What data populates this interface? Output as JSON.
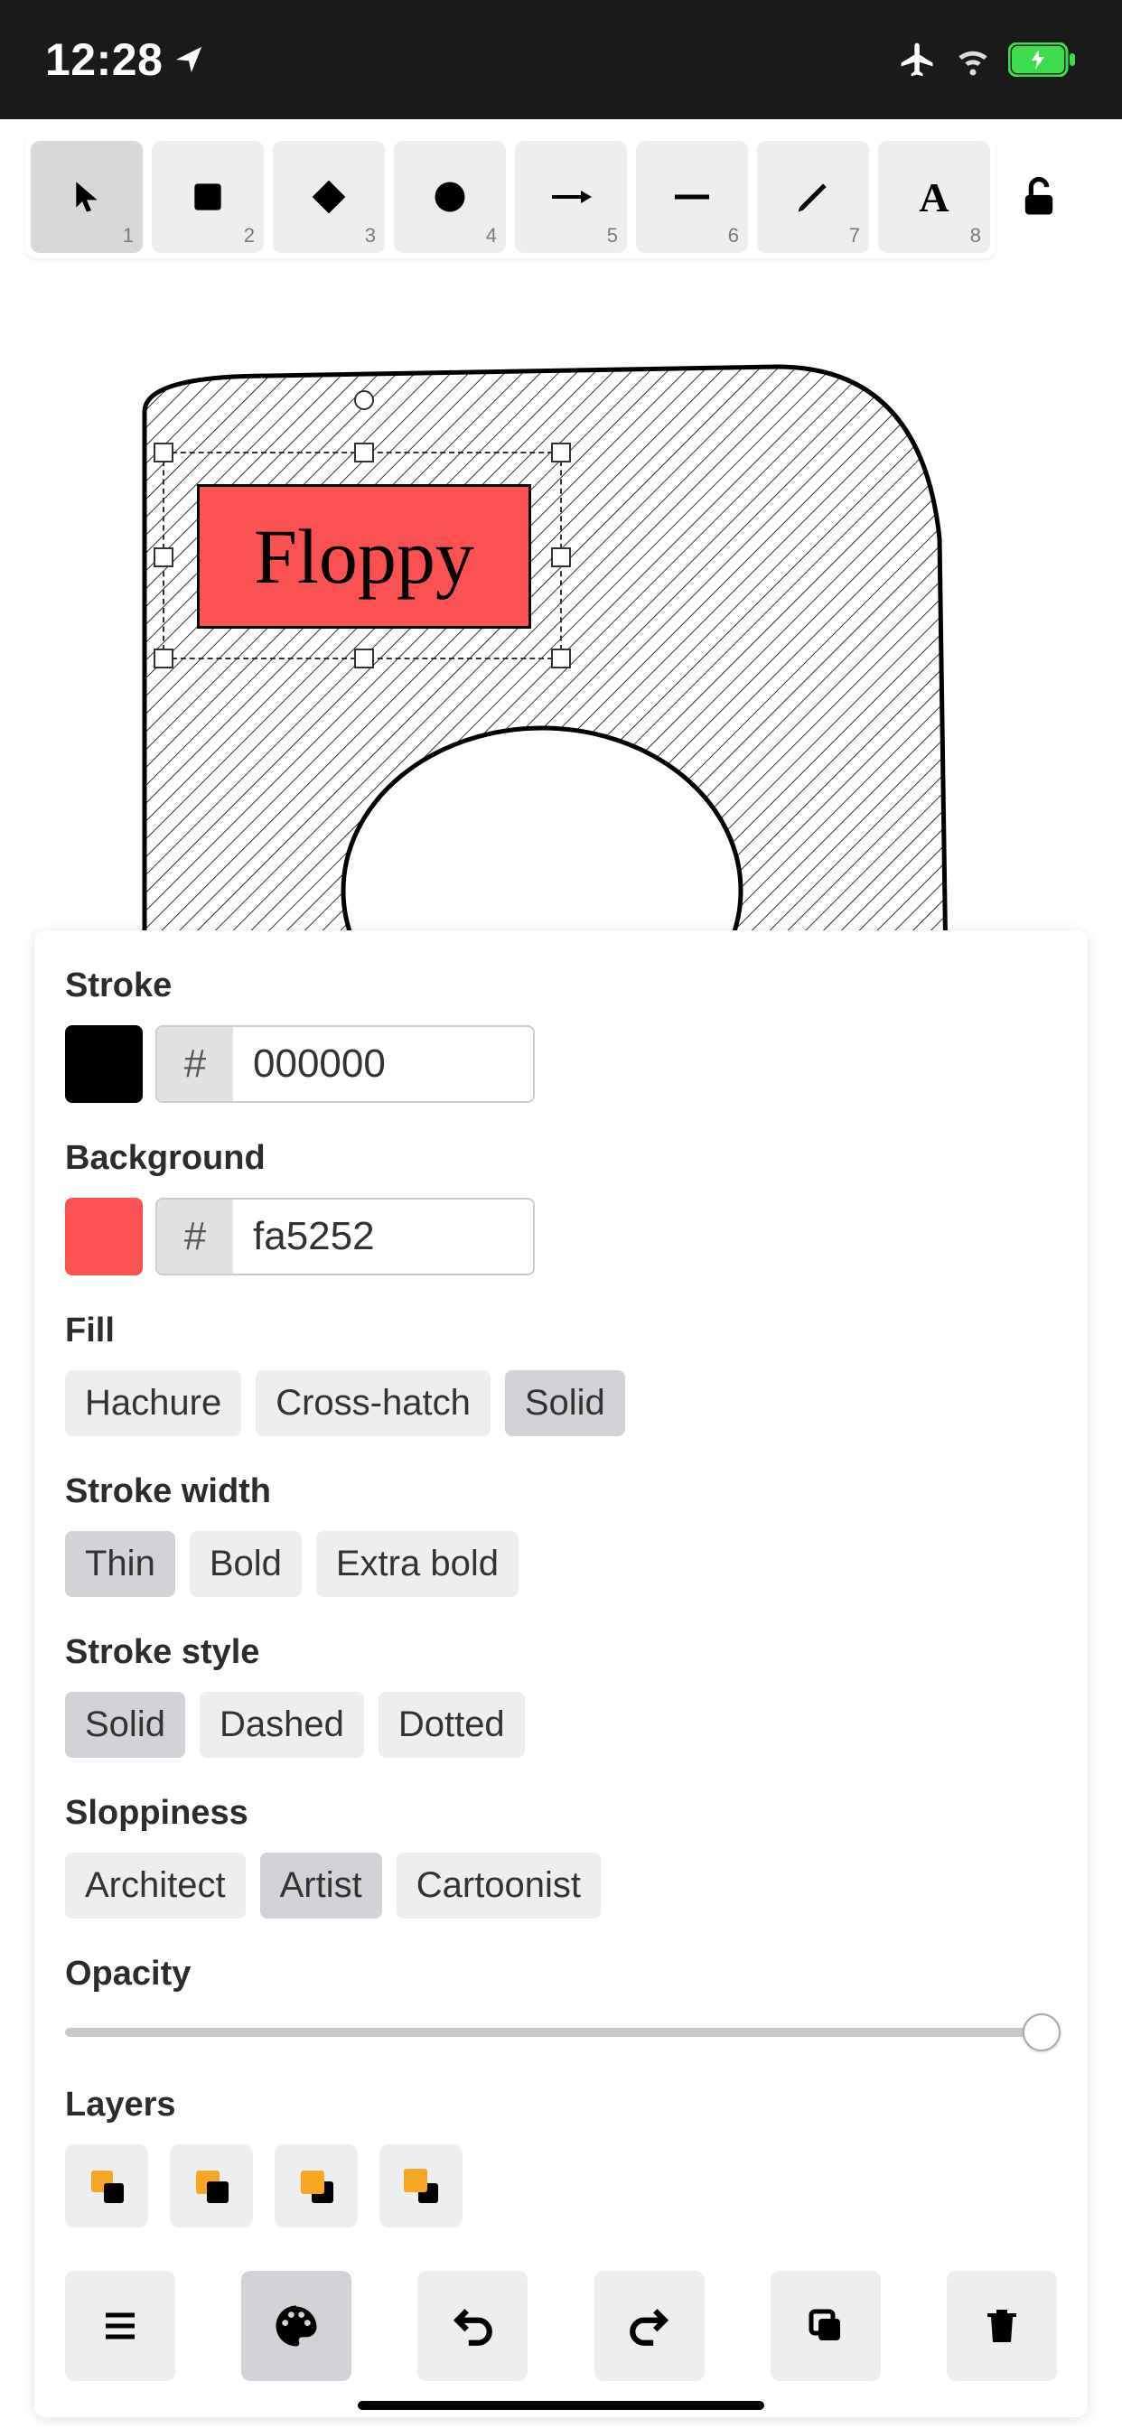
{
  "status": {
    "time": "12:28"
  },
  "toolbar": {
    "tools": [
      {
        "num": "1",
        "icon": "cursor"
      },
      {
        "num": "2",
        "icon": "square"
      },
      {
        "num": "3",
        "icon": "diamond"
      },
      {
        "num": "4",
        "icon": "circle"
      },
      {
        "num": "5",
        "icon": "arrow"
      },
      {
        "num": "6",
        "icon": "line"
      },
      {
        "num": "7",
        "icon": "pencil"
      },
      {
        "num": "8",
        "icon": "text"
      }
    ],
    "active_index": 0
  },
  "canvas": {
    "label_text": "Floppy",
    "label_bg": "#fa5252"
  },
  "props": {
    "stroke_label": "Stroke",
    "stroke_hex": "000000",
    "stroke_color": "#000000",
    "background_label": "Background",
    "background_hex": "fa5252",
    "background_color": "#fa5252",
    "fill_label": "Fill",
    "fill_options": [
      "Hachure",
      "Cross-hatch",
      "Solid"
    ],
    "fill_active": 2,
    "strokewidth_label": "Stroke width",
    "strokewidth_options": [
      "Thin",
      "Bold",
      "Extra bold"
    ],
    "strokewidth_active": 0,
    "strokestyle_label": "Stroke style",
    "strokestyle_options": [
      "Solid",
      "Dashed",
      "Dotted"
    ],
    "strokestyle_active": 0,
    "sloppiness_label": "Sloppiness",
    "sloppiness_options": [
      "Architect",
      "Artist",
      "Cartoonist"
    ],
    "sloppiness_active": 1,
    "opacity_label": "Opacity",
    "opacity_value": 100,
    "layers_label": "Layers"
  },
  "hash_symbol": "#"
}
